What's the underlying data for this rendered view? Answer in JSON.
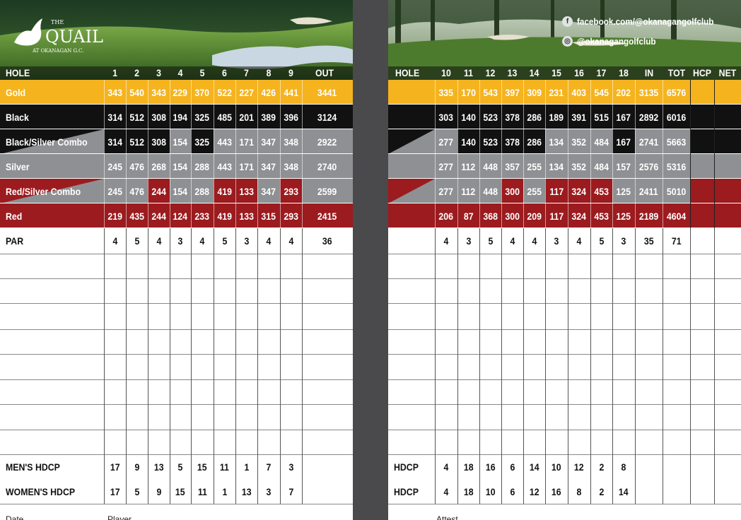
{
  "front": {
    "logo": {
      "the": "THE",
      "name": "QUAIL",
      "subtitle": "AT OKANAGAN G.C."
    },
    "header": {
      "hole": "HOLE",
      "holes": [
        "1",
        "2",
        "3",
        "4",
        "5",
        "6",
        "7",
        "8",
        "9"
      ],
      "total": "OUT"
    },
    "tees": [
      {
        "name": "Gold",
        "values": [
          "343",
          "540",
          "343",
          "229",
          "370",
          "522",
          "227",
          "426",
          "441"
        ],
        "total": "3441"
      },
      {
        "name": "Black",
        "values": [
          "314",
          "512",
          "308",
          "194",
          "325",
          "485",
          "201",
          "389",
          "396"
        ],
        "total": "3124"
      },
      {
        "name": "Black/Silver Combo",
        "values": [
          "314",
          "512",
          "308",
          "154",
          "325",
          "443",
          "171",
          "347",
          "348"
        ],
        "total": "2922"
      },
      {
        "name": "Silver",
        "values": [
          "245",
          "476",
          "268",
          "154",
          "288",
          "443",
          "171",
          "347",
          "348"
        ],
        "total": "2740"
      },
      {
        "name": "Red/Silver Combo",
        "values": [
          "245",
          "476",
          "244",
          "154",
          "288",
          "419",
          "133",
          "347",
          "293"
        ],
        "total": "2599"
      },
      {
        "name": "Red",
        "values": [
          "219",
          "435",
          "244",
          "124",
          "233",
          "419",
          "133",
          "315",
          "293"
        ],
        "total": "2415"
      }
    ],
    "par": {
      "label": "PAR",
      "values": [
        "4",
        "5",
        "4",
        "3",
        "4",
        "5",
        "3",
        "4",
        "4"
      ],
      "total": "36"
    },
    "mens_hdcp": {
      "label": "MEN'S HDCP",
      "values": [
        "17",
        "9",
        "13",
        "5",
        "15",
        "11",
        "1",
        "7",
        "3"
      ]
    },
    "womens_hdcp": {
      "label": "WOMEN'S HDCP",
      "values": [
        "17",
        "5",
        "9",
        "15",
        "11",
        "1",
        "13",
        "3",
        "7"
      ]
    },
    "footer": {
      "date": "Date",
      "player": "Player"
    }
  },
  "back": {
    "social": {
      "facebook": "facebook.com/@okanagangolfclub",
      "instagram": "@okanagangolfclub"
    },
    "header": {
      "hole": "HOLE",
      "holes": [
        "10",
        "11",
        "12",
        "13",
        "14",
        "15",
        "16",
        "17",
        "18"
      ],
      "in": "IN",
      "tot": "TOT",
      "hcp": "HCP",
      "net": "NET"
    },
    "tees": [
      {
        "values": [
          "335",
          "170",
          "543",
          "397",
          "309",
          "231",
          "403",
          "545",
          "202"
        ],
        "in": "3135",
        "tot": "6576"
      },
      {
        "values": [
          "303",
          "140",
          "523",
          "378",
          "286",
          "189",
          "391",
          "515",
          "167"
        ],
        "in": "2892",
        "tot": "6016"
      },
      {
        "values": [
          "277",
          "140",
          "523",
          "378",
          "286",
          "134",
          "352",
          "484",
          "167"
        ],
        "in": "2741",
        "tot": "5663"
      },
      {
        "values": [
          "277",
          "112",
          "448",
          "357",
          "255",
          "134",
          "352",
          "484",
          "157"
        ],
        "in": "2576",
        "tot": "5316"
      },
      {
        "values": [
          "277",
          "112",
          "448",
          "300",
          "255",
          "117",
          "324",
          "453",
          "125"
        ],
        "in": "2411",
        "tot": "5010"
      },
      {
        "values": [
          "206",
          "87",
          "368",
          "300",
          "209",
          "117",
          "324",
          "453",
          "125"
        ],
        "in": "2189",
        "tot": "4604"
      }
    ],
    "par": {
      "values": [
        "4",
        "3",
        "5",
        "4",
        "4",
        "3",
        "4",
        "5",
        "3"
      ],
      "in": "35",
      "tot": "71"
    },
    "mens_hdcp": {
      "label": "HDCP",
      "values": [
        "4",
        "18",
        "16",
        "6",
        "14",
        "10",
        "12",
        "2",
        "8"
      ]
    },
    "womens_hdcp": {
      "label": "HDCP",
      "values": [
        "4",
        "18",
        "10",
        "6",
        "12",
        "16",
        "8",
        "2",
        "14"
      ]
    },
    "footer": {
      "attest": "Attest"
    }
  },
  "colors": {
    "gold": "#f5b31e",
    "black": "#111111",
    "silver": "#8f9093",
    "red": "#9b1b1f",
    "gutter": "#4a4a4c"
  }
}
